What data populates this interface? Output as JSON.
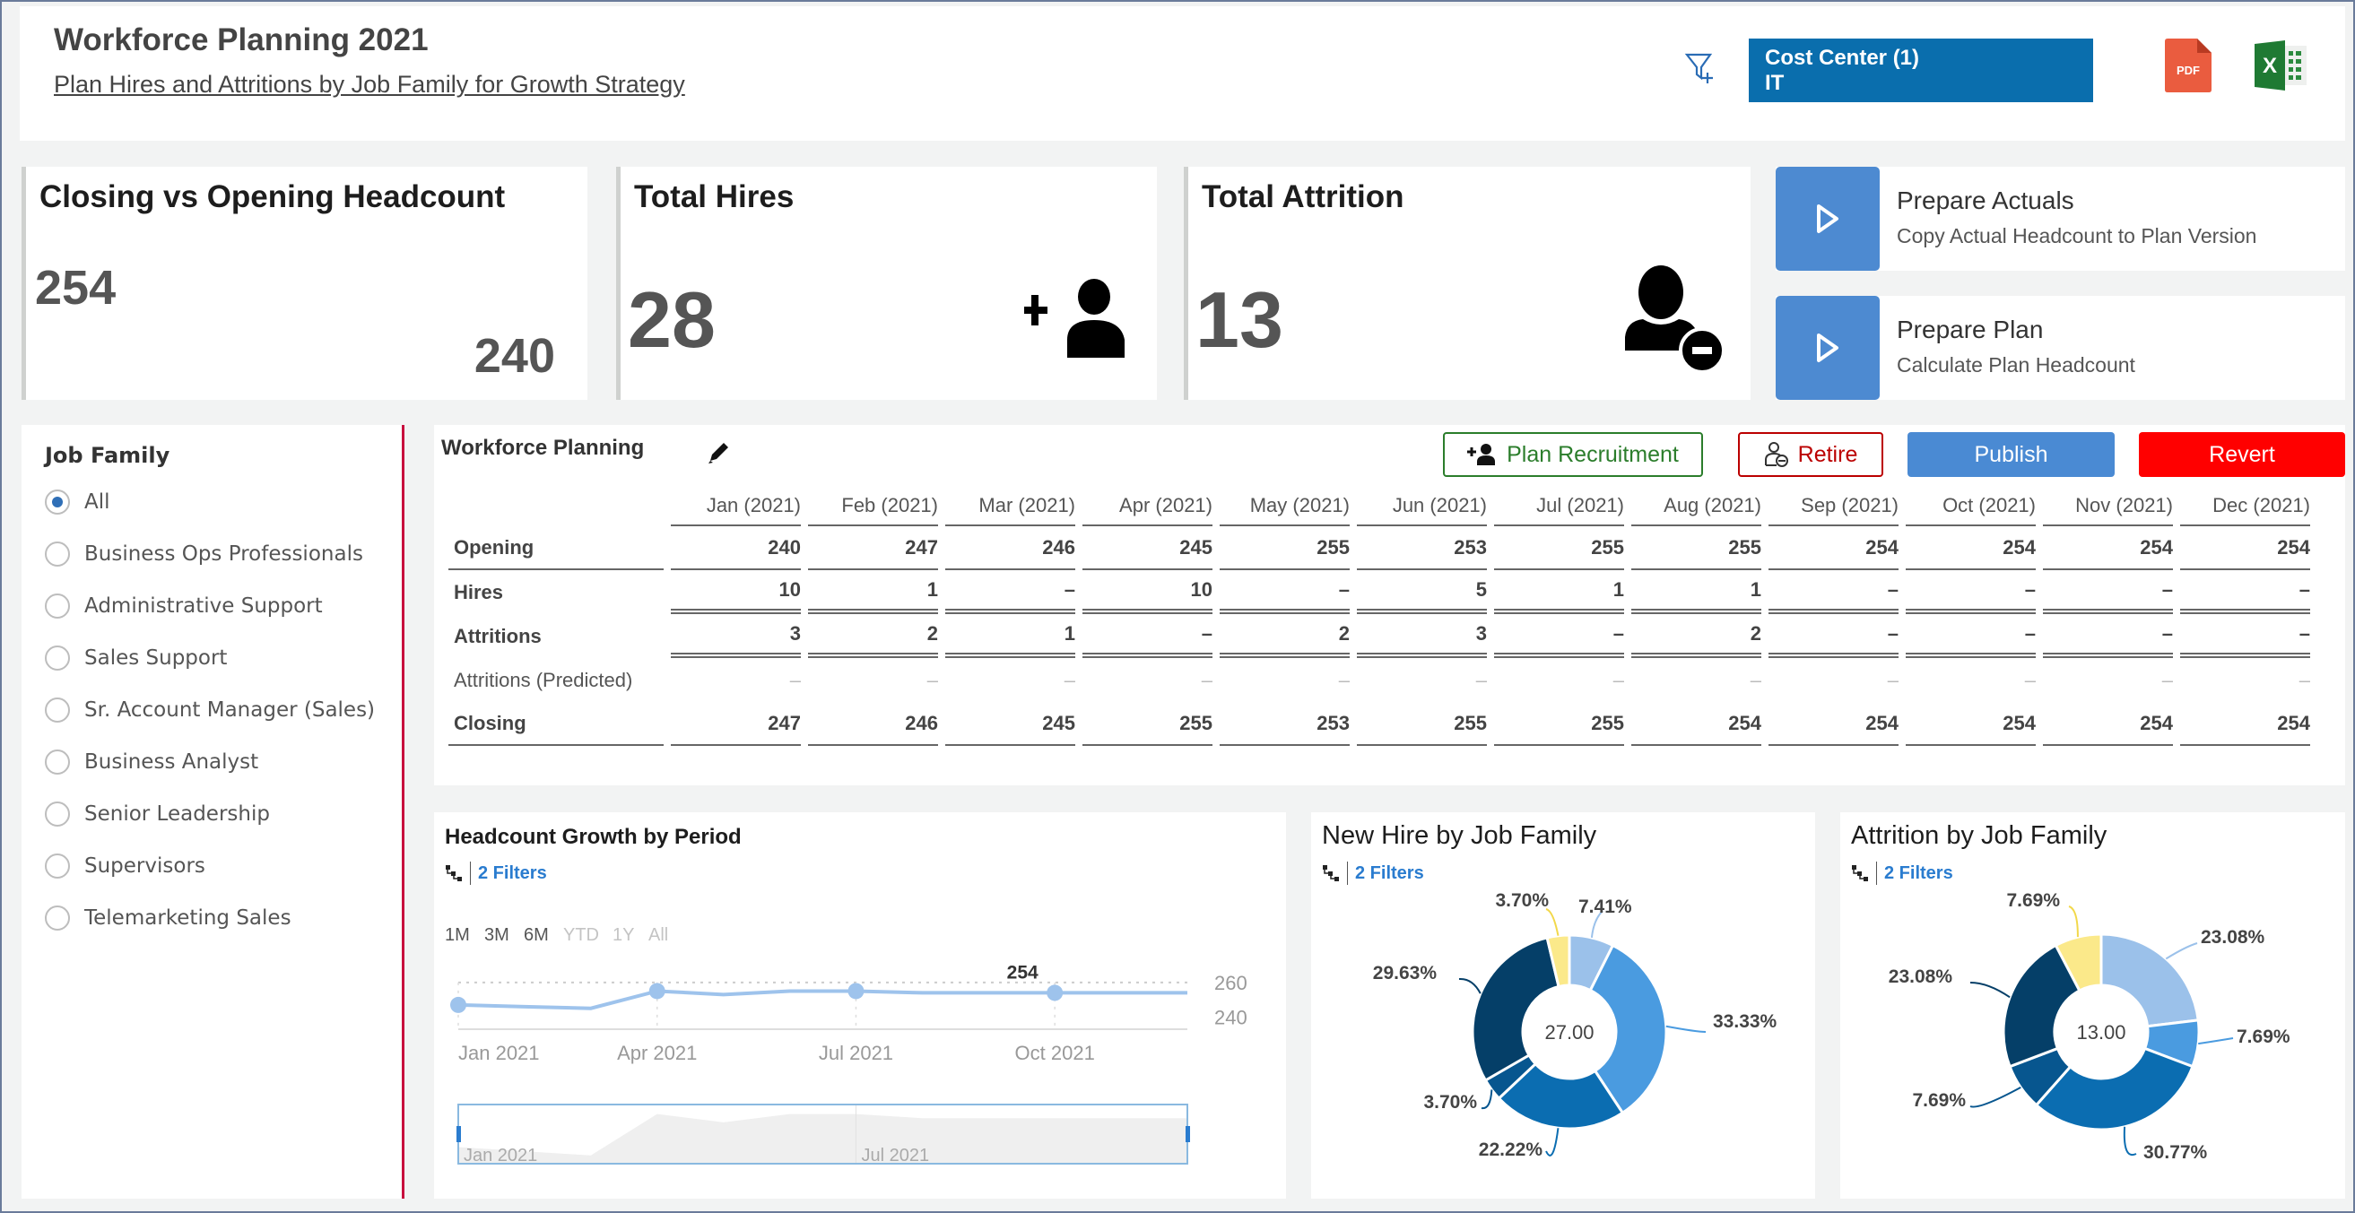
{
  "header": {
    "title": "Workforce Planning 2021",
    "subtitle": "Plan Hires and Attritions by Job Family for Growth Strategy",
    "filter_icon": "filter-add-icon",
    "cost_center_label": "Cost Center (1)",
    "cost_center_value": "IT",
    "export_pdf_icon": "pdf-icon",
    "export_pdf_text": "PDF",
    "export_excel_icon": "excel-icon",
    "export_excel_text": "X"
  },
  "kpis": {
    "closing_vs_opening": {
      "title": "Closing vs Opening Headcount",
      "closing": "254",
      "opening": "240"
    },
    "total_hires": {
      "title": "Total Hires",
      "value": "28",
      "icon": "person-add-icon"
    },
    "total_attrition": {
      "title": "Total Attrition",
      "value": "13",
      "icon": "person-remove-icon"
    }
  },
  "actions": [
    {
      "title": "Prepare Actuals",
      "subtitle": "Copy Actual Headcount to Plan Version",
      "icon": "play-icon"
    },
    {
      "title": "Prepare Plan",
      "subtitle": "Calculate Plan Headcount",
      "icon": "play-icon"
    }
  ],
  "job_family": {
    "title": "Job Family",
    "selected": "All",
    "options": [
      "All",
      "Business Ops Professionals",
      "Administrative Support",
      "Sales Support",
      "Sr. Account Manager (Sales)",
      "Business Analyst",
      "Senior Leadership",
      "Supervisors",
      "Telemarketing Sales"
    ]
  },
  "planning": {
    "title": "Workforce Planning",
    "buttons": {
      "plan_recruitment": "Plan Recruitment",
      "retire": "Retire",
      "publish": "Publish",
      "revert": "Revert"
    },
    "columns": [
      "Jan (2021)",
      "Feb (2021)",
      "Mar (2021)",
      "Apr (2021)",
      "May (2021)",
      "Jun (2021)",
      "Jul (2021)",
      "Aug (2021)",
      "Sep (2021)",
      "Oct (2021)",
      "Nov (2021)",
      "Dec (2021)"
    ],
    "rows": [
      {
        "label": "Opening",
        "values": [
          "240",
          "247",
          "246",
          "245",
          "255",
          "253",
          "255",
          "255",
          "254",
          "254",
          "254",
          "254"
        ]
      },
      {
        "label": "Hires",
        "values": [
          "10",
          "1",
          "–",
          "10",
          "–",
          "5",
          "1",
          "1",
          "–",
          "–",
          "–",
          "–"
        ]
      },
      {
        "label": "Attritions",
        "values": [
          "3",
          "2",
          "1",
          "–",
          "2",
          "3",
          "–",
          "2",
          "–",
          "–",
          "–",
          "–"
        ]
      },
      {
        "label": "Attritions (Predicted)",
        "values": [
          "–",
          "–",
          "–",
          "–",
          "–",
          "–",
          "–",
          "–",
          "–",
          "–",
          "–",
          "–"
        ]
      },
      {
        "label": "Closing",
        "values": [
          "247",
          "246",
          "245",
          "255",
          "253",
          "255",
          "255",
          "254",
          "254",
          "254",
          "254",
          "254"
        ]
      }
    ]
  },
  "filters_label": "2 Filters",
  "chart_data": [
    {
      "type": "line",
      "title": "Headcount Growth by Period",
      "range_buttons": [
        "1M",
        "3M",
        "6M",
        "YTD",
        "1Y",
        "All"
      ],
      "range_enabled": [
        true,
        true,
        true,
        false,
        false,
        false
      ],
      "x": [
        "Jan 2021",
        "Feb 2021",
        "Mar 2021",
        "Apr 2021",
        "May 2021",
        "Jun 2021",
        "Jul 2021",
        "Aug 2021",
        "Sep 2021",
        "Oct 2021",
        "Nov 2021",
        "Dec 2021"
      ],
      "values": [
        247,
        246,
        245,
        255,
        253,
        255,
        255,
        254,
        254,
        254,
        254,
        254
      ],
      "marked_points": [
        "Jan 2021",
        "Apr 2021",
        "Jul 2021",
        "Oct 2021"
      ],
      "data_label": {
        "x": "Oct 2021",
        "text": "254"
      },
      "x_ticks": [
        "Jan 2021",
        "Apr 2021",
        "Jul 2021",
        "Oct 2021"
      ],
      "y_ticks": [
        "260",
        "240"
      ],
      "ylim": [
        235,
        262
      ],
      "navigator_ticks": [
        "Jan 2021",
        "Jul 2021"
      ],
      "series_color": "#9ec3ec"
    },
    {
      "type": "pie",
      "title": "New Hire by Job Family",
      "center_label": "27.00",
      "slices": [
        {
          "value": 7.41,
          "label": "7.41%",
          "color": "#9bc1ea"
        },
        {
          "value": 33.33,
          "label": "33.33%",
          "color": "#4a9be0"
        },
        {
          "value": 22.22,
          "label": "22.22%",
          "color": "#0b6db1"
        },
        {
          "value": 3.7,
          "label": "3.70%",
          "color": "#07568f"
        },
        {
          "value": 29.63,
          "label": "29.63%",
          "color": "#053f68"
        },
        {
          "value": 3.7,
          "label": "3.70%",
          "color": "#fbe98a"
        }
      ]
    },
    {
      "type": "pie",
      "title": "Attrition by Job Family",
      "center_label": "13.00",
      "slices": [
        {
          "value": 23.08,
          "label": "23.08%",
          "color": "#9bc1ea"
        },
        {
          "value": 7.69,
          "label": "7.69%",
          "color": "#4a9be0"
        },
        {
          "value": 30.77,
          "label": "30.77%",
          "color": "#0b6db1"
        },
        {
          "value": 7.69,
          "label": "7.69%",
          "color": "#07568f"
        },
        {
          "value": 23.08,
          "label": "23.08%",
          "color": "#053f68"
        },
        {
          "value": 7.69,
          "label": "7.69%",
          "color": "#fbe98a"
        }
      ]
    }
  ]
}
